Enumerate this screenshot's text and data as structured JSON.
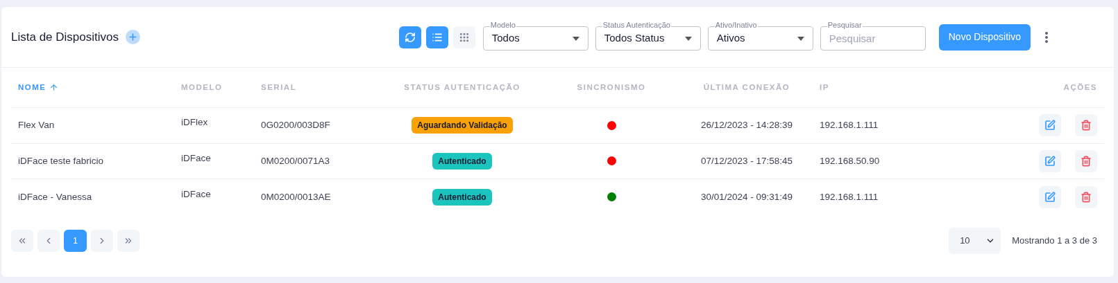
{
  "header": {
    "title": "Lista de Dispositivos"
  },
  "view_toggles": [
    {
      "kind": "refresh",
      "selected": true
    },
    {
      "kind": "list",
      "selected": true
    },
    {
      "kind": "grid",
      "selected": false
    }
  ],
  "filters": [
    {
      "kind": "select",
      "label": "Modelo",
      "value": "Todos"
    },
    {
      "kind": "select",
      "label": "Status Autenticação",
      "value": "Todos Status"
    },
    {
      "kind": "select",
      "label": "Ativo/Inativo",
      "value": "Ativos"
    },
    {
      "kind": "search",
      "label": "Pesquisar",
      "placeholder": "Pesquisar"
    }
  ],
  "new_button": "Novo Dispositivo",
  "table": {
    "columns": [
      {
        "label": "NOME",
        "sorted": true
      },
      {
        "label": "MODELO",
        "sorted": false
      },
      {
        "label": "SERIAL",
        "sorted": false
      },
      {
        "label": "STATUS AUTENTICAÇÃO",
        "sorted": false
      },
      {
        "label": "SINCRONISMO",
        "sorted": false
      },
      {
        "label": "ÚLTIMA CONEXÃO",
        "sorted": false
      },
      {
        "label": "IP",
        "sorted": false
      },
      {
        "label": "AÇÕES",
        "sorted": false
      }
    ],
    "rows": [
      {
        "name": "Flex Van",
        "model": "iDFlex",
        "serial": "0G0200/003D8F",
        "status": {
          "label": "Aguardando Validação",
          "color": "#f9a106"
        },
        "sync": {
          "color": "#ff0000"
        },
        "last_connection": "26/12/2023 - 14:28:39",
        "ip": "192.168.1.111"
      },
      {
        "name": "iDFace teste fabricio",
        "model": "iDFace",
        "serial": "0M0200/0071A3",
        "status": {
          "label": "Autenticado",
          "color": "#1bc5bd"
        },
        "sync": {
          "color": "#ff0000"
        },
        "last_connection": "07/12/2023 - 17:58:45",
        "ip": "192.168.50.90"
      },
      {
        "name": "iDFace - Vanessa",
        "model": "iDFace",
        "serial": "0M0200/0013AE",
        "status": {
          "label": "Autenticado",
          "color": "#1bc5bd"
        },
        "sync": {
          "color": "#008000"
        },
        "last_connection": "30/01/2024 - 09:31:49",
        "ip": "192.168.1.111"
      }
    ]
  },
  "pagination": {
    "pages": [
      {
        "label": "1",
        "selected": true
      }
    ],
    "page_size": "10",
    "summary": "Mostrando 1 a 3 de 3"
  }
}
